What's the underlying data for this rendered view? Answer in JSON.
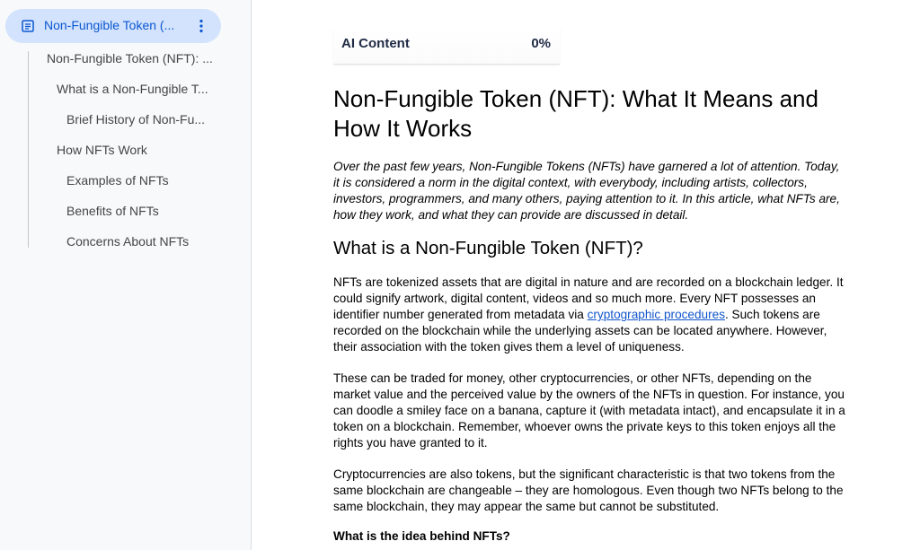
{
  "outline": {
    "document_title": "Non-Fungible Token (...",
    "items": [
      {
        "label": "Non-Fungible Token (NFT): ..."
      },
      {
        "label": "What is a Non-Fungible T..."
      },
      {
        "label": "Brief History of Non-Fu..."
      },
      {
        "label": "How NFTs Work"
      },
      {
        "label": "Examples of NFTs"
      },
      {
        "label": "Benefits of NFTs"
      },
      {
        "label": "Concerns About NFTs"
      }
    ]
  },
  "ai_detector": {
    "label": "AI Content",
    "value": "0%"
  },
  "article": {
    "title": "Non-Fungible Token (NFT): What It Means and How It Works",
    "intro": "Over the past few years, Non-Fungible Tokens (NFTs) have garnered a lot of attention. Today, it is considered a norm in the digital context, with everybody, including artists, collectors, investors, programmers, and many others, paying attention to it. In this article, what NFTs are, how they work, and what they can provide are discussed in detail.",
    "section_heading": "What is a Non-Fungible Token (NFT)?",
    "p1_before": "NFTs are tokenized assets that are digital in nature and are recorded on a blockchain ledger. It could signify artwork, digital content, videos and so much more. Every NFT possesses an identifier number generated from metadata via ",
    "p1_link": "cryptographic procedures",
    "p1_after": ". Such tokens are recorded on the blockchain while the underlying assets can be located anywhere. However, their association with the token gives them a level of uniqueness.",
    "p2": "These can be traded for money, other cryptocurrencies, or other NFTs, depending on the market value and the perceived value by the owners of the NFTs in question. For instance, you can doodle a smiley face on a banana, capture it (with metadata intact), and encapsulate it in a token on a blockchain. Remember, whoever owns the private keys to this token enjoys all the rights you have granted to it.",
    "p3": "Cryptocurrencies are also tokens, but the significant characteristic is that two tokens from the same blockchain are changeable – they are homologous. Even though two NFTs belong to the same blockchain, they may appear the same but cannot be substituted.",
    "subheading": "What is the idea behind NFTs?"
  }
}
